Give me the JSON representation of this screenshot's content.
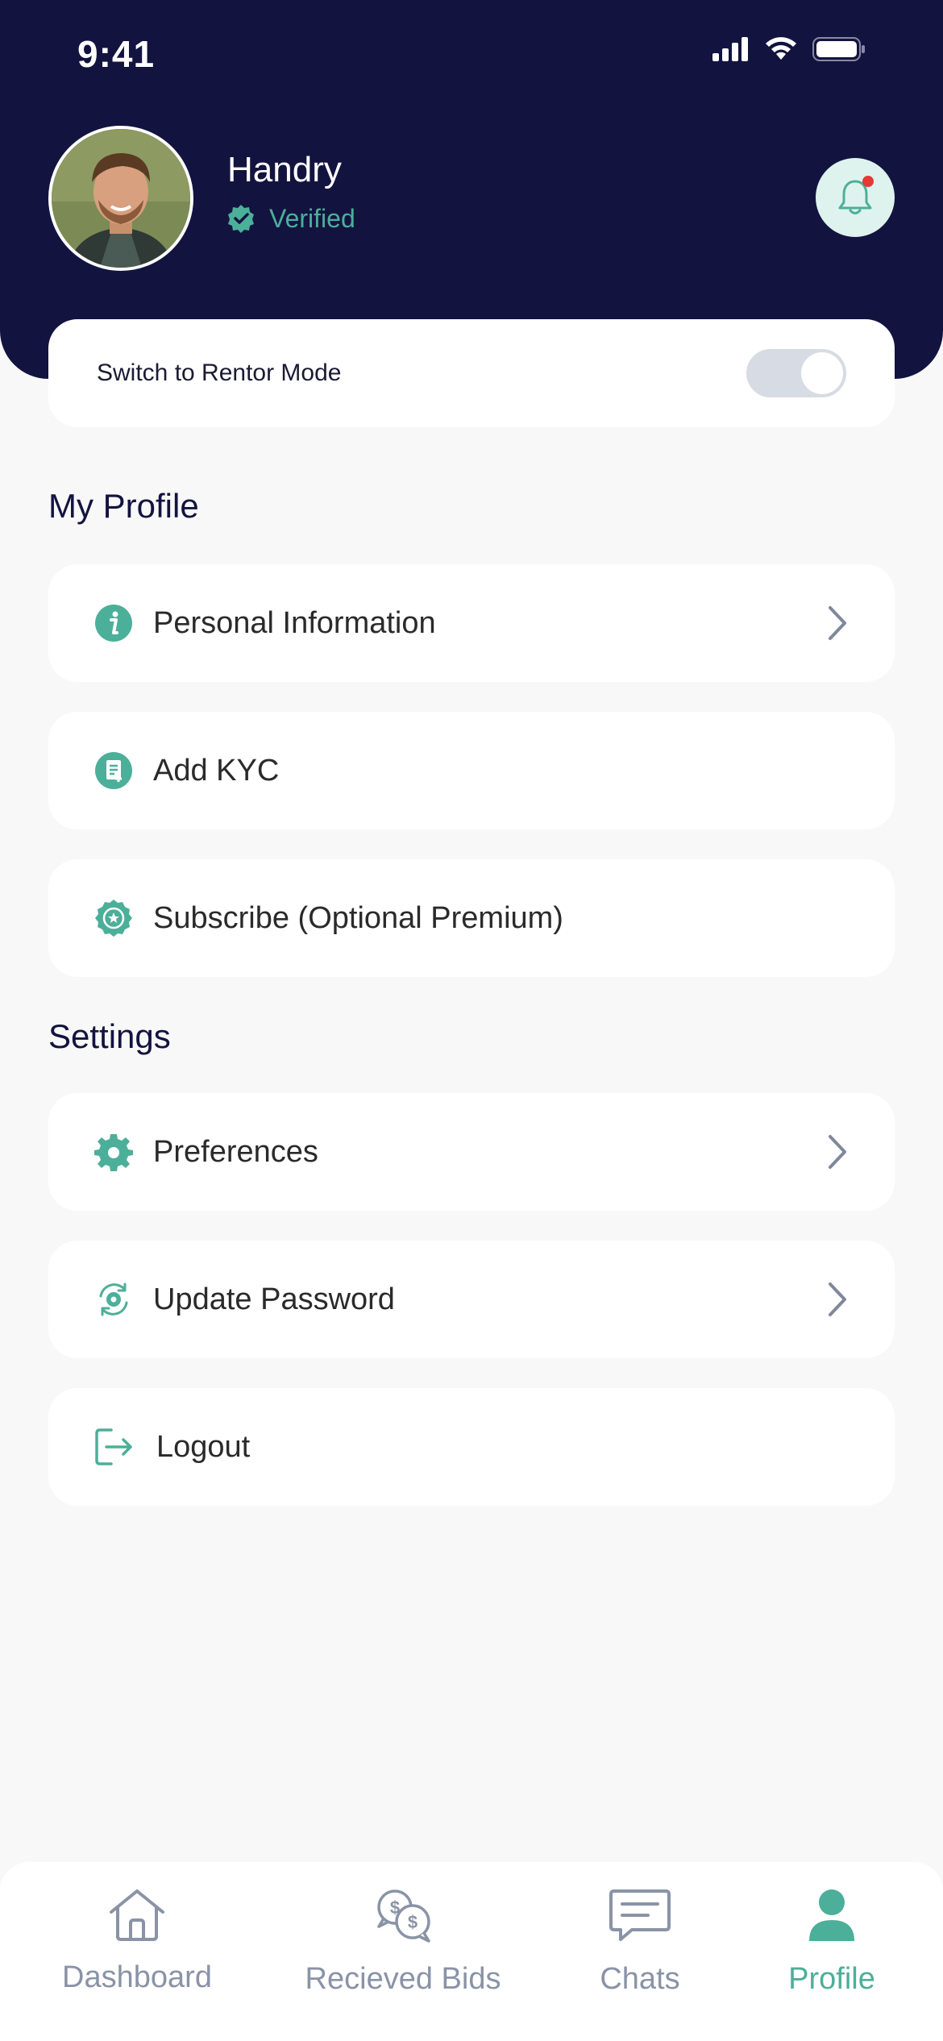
{
  "status_bar": {
    "time": "9:41"
  },
  "header": {
    "user_name": "Handry",
    "verified_label": "Verified"
  },
  "rentor_switch": {
    "label": "Switch to Rentor Mode",
    "enabled": false
  },
  "my_profile": {
    "title": "My Profile",
    "items": [
      {
        "label": "Personal Information",
        "icon": "info-icon",
        "has_chevron": true
      },
      {
        "label": "Add KYC",
        "icon": "document-icon",
        "has_chevron": false
      },
      {
        "label": "Subscribe (Optional Premium)",
        "icon": "premium-badge-icon",
        "has_chevron": false
      }
    ]
  },
  "settings": {
    "title": "Settings",
    "items": [
      {
        "label": "Preferences",
        "icon": "gear-icon",
        "has_chevron": true
      },
      {
        "label": "Update Password",
        "icon": "refresh-lock-icon",
        "has_chevron": true
      },
      {
        "label": "Logout",
        "icon": "logout-icon",
        "has_chevron": false
      }
    ]
  },
  "bottom_nav": {
    "items": [
      {
        "label": "Dashboard",
        "icon": "home-icon",
        "active": false
      },
      {
        "label": "Recieved Bids",
        "icon": "bids-icon",
        "active": false
      },
      {
        "label": "Chats",
        "icon": "chat-icon",
        "active": false
      },
      {
        "label": "Profile",
        "icon": "person-icon",
        "active": true
      }
    ]
  },
  "colors": {
    "header_bg": "#131340",
    "accent": "#4caf99",
    "notification_dot": "#e53935",
    "background": "#f8f8f8"
  }
}
